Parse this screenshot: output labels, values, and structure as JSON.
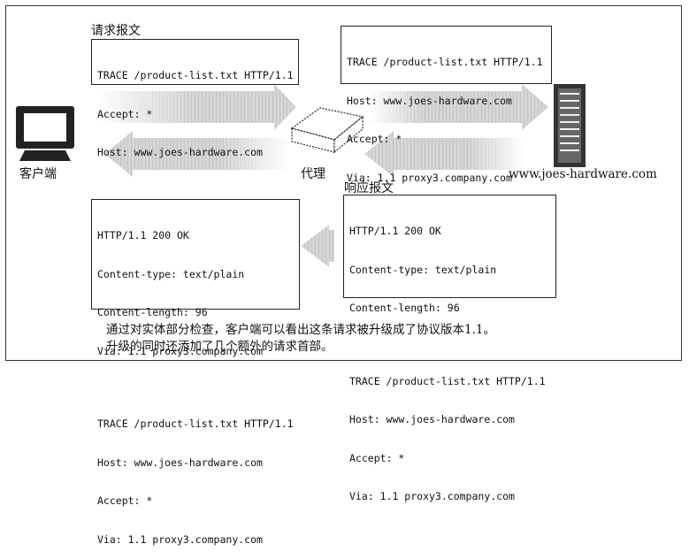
{
  "request_label": "请求报文",
  "response_label": "响应报文",
  "client_label": "客户端",
  "proxy_label": "代理",
  "server_label": "www.joes-hardware.com",
  "client_request": [
    "TRACE /product-list.txt HTTP/1.1",
    "Accept: *",
    "Host: www.joes-hardware.com"
  ],
  "proxy_request": [
    "TRACE /product-list.txt HTTP/1.1",
    "Host: www.joes-hardware.com",
    "Accept: *",
    "Via: 1.1 proxy3.company.com"
  ],
  "server_response": {
    "headers": [
      "HTTP/1.1 200 OK",
      "Content-type: text/plain",
      "Content-length: 96"
    ],
    "body": [
      "TRACE /product-list.txt HTTP/1.1",
      "Host: www.joes-hardware.com",
      "Accept: *",
      "Via: 1.1 proxy3.company.com"
    ]
  },
  "client_response": {
    "headers": [
      "HTTP/1.1 200 OK",
      "Content-type: text/plain",
      "Content-length: 96",
      "Via: 1.1 proxy3.company.com"
    ],
    "body": [
      "TRACE /product-list.txt HTTP/1.1",
      "Host: www.joes-hardware.com",
      "Accept: *",
      "Via: 1.1 proxy3.company.com"
    ]
  },
  "caption": [
    "通过对实体部分检查，客户端可以看出这条请求被升级成了协议版本1.1。",
    "升级的同时还添加了几个额外的请求首部。"
  ],
  "icons": {
    "client": "computer-icon",
    "proxy": "proxy-box-icon",
    "server": "server-icon"
  }
}
